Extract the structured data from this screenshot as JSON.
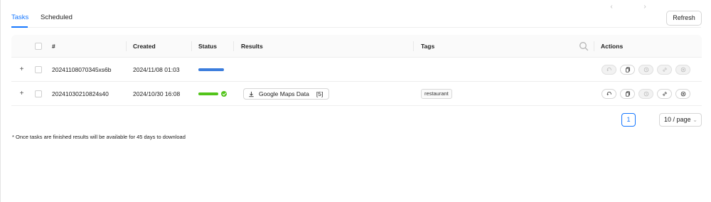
{
  "tabs": [
    {
      "label": "Tasks",
      "active": true
    },
    {
      "label": "Scheduled",
      "active": false
    }
  ],
  "refresh_label": "Refresh",
  "table": {
    "columns": {
      "number": "#",
      "created": "Created",
      "status": "Status",
      "results": "Results",
      "tags": "Tags",
      "actions": "Actions"
    },
    "search_icon": "search-icon",
    "rows": [
      {
        "id": "20241108070345xs6b",
        "created": "2024/11/08 01:03",
        "status": "running",
        "progress": 1.0,
        "progress_color": "#3b7ddd",
        "result_label": "",
        "result_count": "",
        "tag": "",
        "actions_enabled": false
      },
      {
        "id": "20241030210824s40",
        "created": "2024/10/30 16:08",
        "status": "completed",
        "progress": 1.0,
        "progress_color": "#52c41a",
        "result_label": "Google Maps Data",
        "result_count": "[5]",
        "tag": "restaurant",
        "actions_enabled": true
      }
    ],
    "action_icons": [
      "retry-icon",
      "copy-icon",
      "schedule-icon",
      "link-icon",
      "cancel-icon"
    ]
  },
  "pagination": {
    "current_page": "1",
    "page_size": "10 / page"
  },
  "footnote": "* Once tasks are finished results will be available for 45 days to download",
  "colors": {
    "accent": "#1677ff",
    "success": "#52c41a",
    "running": "#3b7ddd"
  }
}
